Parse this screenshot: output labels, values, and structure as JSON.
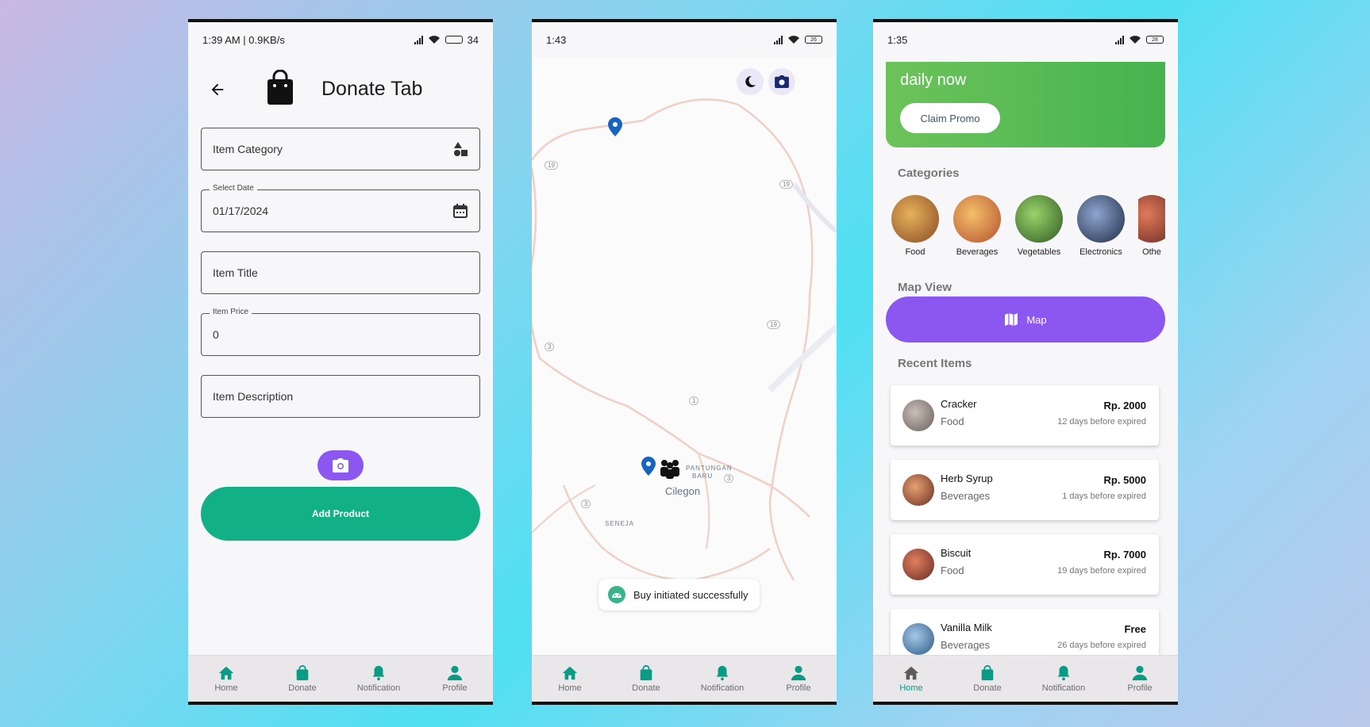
{
  "nav": {
    "items": [
      "Home",
      "Donate",
      "Notification",
      "Profile"
    ]
  },
  "phone1": {
    "status_time": "1:39 AM | 0.9KB/s",
    "status_battery": "34",
    "title": "Donate Tab",
    "fields": {
      "category_placeholder": "Item Category",
      "date_label": "Select Date",
      "date_value": "01/17/2024",
      "title_placeholder": "Item Title",
      "price_label": "Item Price",
      "price_value": "0",
      "description_placeholder": "Item Description"
    },
    "add_button": "Add Product"
  },
  "phone2": {
    "status_time": "1:43",
    "status_battery": "26",
    "map_labels": {
      "city": "Cilegon",
      "district": "PANTUNGAN BARU",
      "district_line1": "PANTUNGAN",
      "district_line2": "BARU",
      "area": "SENEJA"
    },
    "road_markers": [
      "19",
      "19",
      "19",
      "3",
      "1",
      "3",
      "3"
    ],
    "toast": "Buy initiated successfully"
  },
  "phone3": {
    "status_time": "1:35",
    "status_battery": "28",
    "promo_text": "daily now",
    "promo_button": "Claim Promo",
    "categories_title": "Categories",
    "categories": [
      {
        "label": "Food",
        "color": "#b9743a"
      },
      {
        "label": "Beverages",
        "color": "#d88a38"
      },
      {
        "label": "Vegetables",
        "color": "#3f7a2e"
      },
      {
        "label": "Electronics",
        "color": "#3a4a66"
      },
      {
        "label": "Othe",
        "color": "#a83a2e"
      }
    ],
    "map_view_title": "Map View",
    "map_button": "Map",
    "recent_title": "Recent Items",
    "items": [
      {
        "name": "Cracker",
        "category": "Food",
        "price": "Rp. 2000",
        "expiry": "12 days before expired",
        "color": "#8a7c74"
      },
      {
        "name": "Herb Syrup",
        "category": "Beverages",
        "price": "Rp. 5000",
        "expiry": "1 days before expired",
        "color": "#b05a3a"
      },
      {
        "name": "Biscuit",
        "category": "Food",
        "price": "Rp. 7000",
        "expiry": "19 days before expired",
        "color": "#a6433a"
      },
      {
        "name": "Vanilla Milk",
        "category": "Beverages",
        "price": "Free",
        "expiry": "26 days before expired",
        "color": "#5a8fb4"
      }
    ]
  },
  "colors": {
    "accent_green": "#12b086",
    "accent_purple": "#8b57f0",
    "nav_active": "#0a9b84",
    "promo_green": "#52b852"
  }
}
